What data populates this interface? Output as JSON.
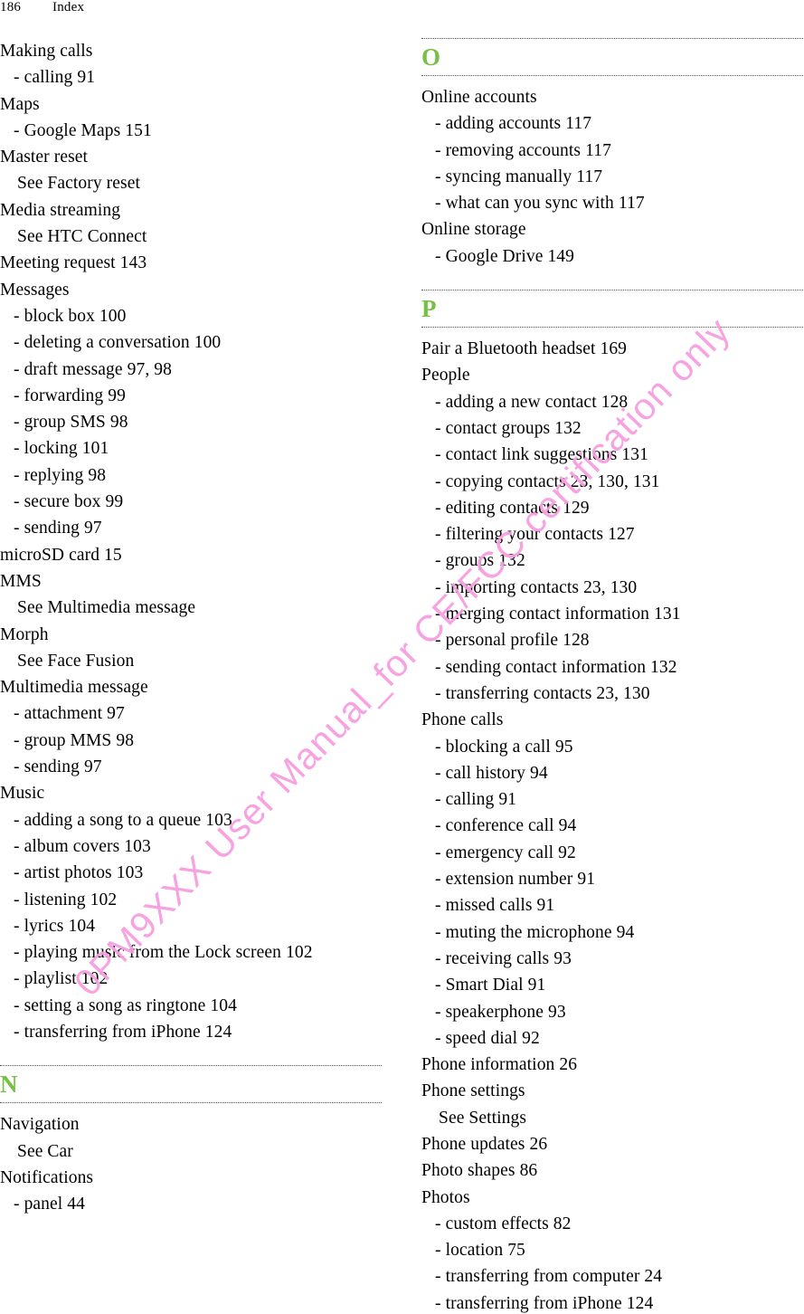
{
  "header": {
    "page_number": "186",
    "title": "Index"
  },
  "watermark": {
    "text": "0PM9XXX User Manual_for CE/FCC certification only",
    "color": "#f79fe0"
  },
  "section_letter_color": "#76c043",
  "left_column": {
    "entries": [
      {
        "level": 0,
        "text": "Making calls",
        "num": ""
      },
      {
        "level": 1,
        "text": "- calling",
        "num": "91"
      },
      {
        "level": 0,
        "text": "Maps",
        "num": ""
      },
      {
        "level": 1,
        "text": "- Google Maps",
        "num": "151"
      },
      {
        "level": 0,
        "text": "Master reset",
        "num": ""
      },
      {
        "level": 2,
        "text": "See Factory reset",
        "num": ""
      },
      {
        "level": 0,
        "text": "Media streaming",
        "num": ""
      },
      {
        "level": 2,
        "text": "See HTC Connect",
        "num": ""
      },
      {
        "level": 0,
        "text": "Meeting request",
        "num": "143"
      },
      {
        "level": 0,
        "text": "Messages",
        "num": ""
      },
      {
        "level": 1,
        "text": "- block box",
        "num": "100"
      },
      {
        "level": 1,
        "text": "- deleting a conversation",
        "num": "100"
      },
      {
        "level": 1,
        "text": "- draft message",
        "num": "97, 98"
      },
      {
        "level": 1,
        "text": "- forwarding",
        "num": "99"
      },
      {
        "level": 1,
        "text": "- group SMS",
        "num": "98"
      },
      {
        "level": 1,
        "text": "- locking",
        "num": "101"
      },
      {
        "level": 1,
        "text": "- replying",
        "num": "98"
      },
      {
        "level": 1,
        "text": "- secure box",
        "num": "99"
      },
      {
        "level": 1,
        "text": "- sending",
        "num": "97"
      },
      {
        "level": 0,
        "text": "microSD card",
        "num": "15"
      },
      {
        "level": 0,
        "text": "MMS",
        "num": ""
      },
      {
        "level": 2,
        "text": "See Multimedia message",
        "num": ""
      },
      {
        "level": 0,
        "text": "Morph",
        "num": ""
      },
      {
        "level": 2,
        "text": "See Face Fusion",
        "num": ""
      },
      {
        "level": 0,
        "text": "Multimedia message",
        "num": ""
      },
      {
        "level": 1,
        "text": "- attachment",
        "num": "97"
      },
      {
        "level": 1,
        "text": "- group MMS",
        "num": "98"
      },
      {
        "level": 1,
        "text": "- sending",
        "num": "97"
      },
      {
        "level": 0,
        "text": "Music",
        "num": ""
      },
      {
        "level": 1,
        "text": "- adding a song to a queue",
        "num": "103"
      },
      {
        "level": 1,
        "text": "- album covers",
        "num": "103"
      },
      {
        "level": 1,
        "text": "- artist photos",
        "num": "103"
      },
      {
        "level": 1,
        "text": "- listening",
        "num": "102"
      },
      {
        "level": 1,
        "text": "- lyrics",
        "num": "104"
      },
      {
        "level": 1,
        "text": "- playing music from the Lock screen",
        "num": "102"
      },
      {
        "level": 1,
        "text": "- playlist",
        "num": "102"
      },
      {
        "level": 1,
        "text": "- setting a song as ringtone",
        "num": "104"
      },
      {
        "level": 1,
        "text": "- transferring from iPhone",
        "num": "124"
      }
    ],
    "section": {
      "letter": "N",
      "entries": [
        {
          "level": 0,
          "text": "Navigation",
          "num": ""
        },
        {
          "level": 2,
          "text": "See Car",
          "num": ""
        },
        {
          "level": 0,
          "text": "Notifications",
          "num": ""
        },
        {
          "level": 1,
          "text": "- panel",
          "num": "44"
        }
      ]
    }
  },
  "right_column": {
    "section_o": {
      "letter": "O",
      "entries": [
        {
          "level": 0,
          "text": "Online accounts",
          "num": ""
        },
        {
          "level": 1,
          "text": "- adding accounts",
          "num": "117"
        },
        {
          "level": 1,
          "text": "- removing accounts",
          "num": "117"
        },
        {
          "level": 1,
          "text": "- syncing manually",
          "num": "117"
        },
        {
          "level": 1,
          "text": "- what can you sync with",
          "num": "117"
        },
        {
          "level": 0,
          "text": "Online storage",
          "num": ""
        },
        {
          "level": 1,
          "text": "- Google Drive",
          "num": "149"
        }
      ]
    },
    "section_p": {
      "letter": "P",
      "entries": [
        {
          "level": 0,
          "text": "Pair a Bluetooth headset",
          "num": "169"
        },
        {
          "level": 0,
          "text": "People",
          "num": ""
        },
        {
          "level": 1,
          "text": "- adding a new contact",
          "num": "128"
        },
        {
          "level": 1,
          "text": "- contact groups",
          "num": "132"
        },
        {
          "level": 1,
          "text": "- contact link suggestions",
          "num": "131"
        },
        {
          "level": 1,
          "text": "- copying contacts",
          "num": "23, 130, 131"
        },
        {
          "level": 1,
          "text": "- editing contacts",
          "num": "129"
        },
        {
          "level": 1,
          "text": "- filtering your contacts",
          "num": "127"
        },
        {
          "level": 1,
          "text": "- groups",
          "num": "132"
        },
        {
          "level": 1,
          "text": "- importing contacts",
          "num": "23, 130"
        },
        {
          "level": 1,
          "text": "- merging contact information",
          "num": "131"
        },
        {
          "level": 1,
          "text": "- personal profile",
          "num": "128"
        },
        {
          "level": 1,
          "text": "- sending contact information",
          "num": "132"
        },
        {
          "level": 1,
          "text": "- transferring contacts",
          "num": "23, 130"
        },
        {
          "level": 0,
          "text": "Phone calls",
          "num": ""
        },
        {
          "level": 1,
          "text": "- blocking a call",
          "num": "95"
        },
        {
          "level": 1,
          "text": "- call history",
          "num": "94"
        },
        {
          "level": 1,
          "text": "- calling",
          "num": "91"
        },
        {
          "level": 1,
          "text": "- conference call",
          "num": "94"
        },
        {
          "level": 1,
          "text": "- emergency call",
          "num": "92"
        },
        {
          "level": 1,
          "text": "- extension number",
          "num": "91"
        },
        {
          "level": 1,
          "text": "- missed calls",
          "num": "91"
        },
        {
          "level": 1,
          "text": "- muting the microphone",
          "num": "94"
        },
        {
          "level": 1,
          "text": "- receiving calls",
          "num": "93"
        },
        {
          "level": 1,
          "text": "- Smart Dial",
          "num": "91"
        },
        {
          "level": 1,
          "text": "- speakerphone",
          "num": "93"
        },
        {
          "level": 1,
          "text": "- speed dial",
          "num": "92"
        },
        {
          "level": 0,
          "text": "Phone information",
          "num": "26"
        },
        {
          "level": 0,
          "text": "Phone settings",
          "num": ""
        },
        {
          "level": 2,
          "text": "See Settings",
          "num": ""
        },
        {
          "level": 0,
          "text": "Phone updates",
          "num": "26"
        },
        {
          "level": 0,
          "text": "Photo shapes",
          "num": "86"
        },
        {
          "level": 0,
          "text": "Photos",
          "num": ""
        },
        {
          "level": 1,
          "text": "- custom effects",
          "num": "82"
        },
        {
          "level": 1,
          "text": "- location",
          "num": "75"
        },
        {
          "level": 1,
          "text": "- transferring from computer",
          "num": "24"
        },
        {
          "level": 1,
          "text": "- transferring from iPhone",
          "num": "124"
        }
      ]
    }
  }
}
